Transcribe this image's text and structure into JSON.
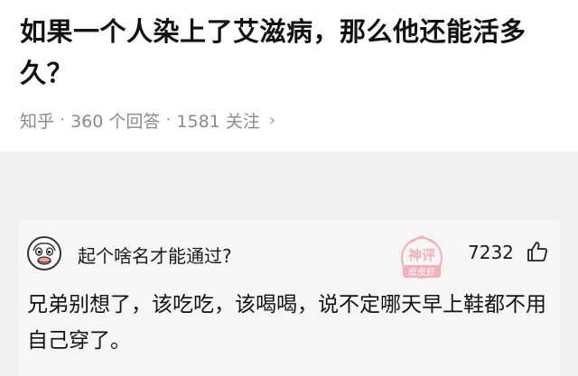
{
  "question": {
    "title": "如果一个人染上了艾滋病，那么他还能活多久？",
    "source": "知乎",
    "separator": "·",
    "answers_count": "360 个回答",
    "followers_count": "1581 关注",
    "chevron_icon": "chevron-right-icon"
  },
  "answer": {
    "author_name": "起个啥名才能通过?",
    "avatar_icon": "cartoon-avatar",
    "likes": "7232",
    "like_icon": "thumbs-up-icon",
    "text": "兄弟别想了，该吃吃，该喝喝，说不定哪天早上鞋都不用自己穿了。"
  },
  "watermark": {
    "line1": "神评",
    "line2": "皮皮虾",
    "color": "#f07a8a"
  }
}
